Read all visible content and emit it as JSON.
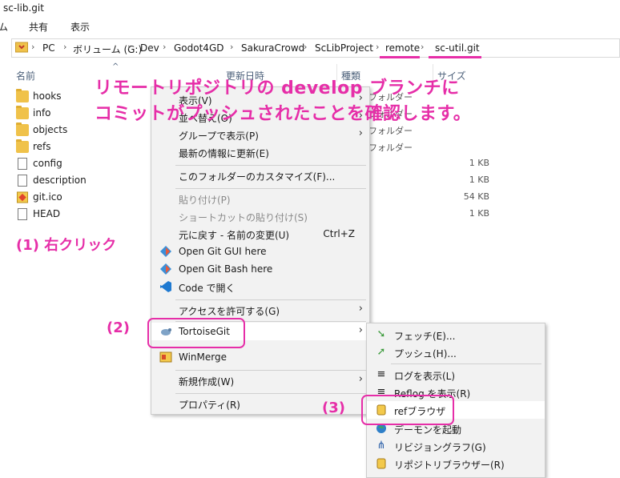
{
  "window": {
    "title": "sc-lib.git"
  },
  "ribbon": {
    "tabs": [
      "ム",
      "共有",
      "表示"
    ]
  },
  "address": {
    "crumbs": [
      "PC",
      "ボリューム (G:)",
      "Dev",
      "Godot4GD",
      "SakuraCrowd",
      "ScLibProject",
      "remote",
      "sc-util.git"
    ],
    "separator": "›"
  },
  "columns": {
    "name": "名前",
    "date": "更新日時",
    "type": "種類",
    "size": "サイズ"
  },
  "files": [
    {
      "name": "hooks",
      "kind": "folder",
      "type": "",
      "size": ""
    },
    {
      "name": "info",
      "kind": "folder",
      "type": "",
      "size": ""
    },
    {
      "name": "objects",
      "kind": "folder",
      "type": "フォルダー",
      "size": ""
    },
    {
      "name": "refs",
      "kind": "folder",
      "type": "フォルダー",
      "size": ""
    },
    {
      "name": "config",
      "kind": "file",
      "type": "",
      "size": "1 KB"
    },
    {
      "name": "description",
      "kind": "file",
      "type": "",
      "size": "1 KB"
    },
    {
      "name": "git.ico",
      "kind": "icon",
      "type": "",
      "size": "54 KB"
    },
    {
      "name": "HEAD",
      "kind": "file",
      "type": "",
      "size": "1 KB"
    }
  ],
  "folder_type_partial": "フォルダー",
  "annotations": {
    "headline_line1": "リモートリポジトリの develop ブランチに",
    "headline_line2": "コミットがプッシュされたことを確認します。",
    "step1": "(1) 右クリック",
    "step2": "(2)",
    "step3": "(3)"
  },
  "context_menu": {
    "items": [
      {
        "label": "表示(V)",
        "arrow": "›"
      },
      {
        "label": "並べ替え(O)",
        "arrow": "›"
      },
      {
        "label": "グループで表示(P)",
        "arrow": "›"
      },
      {
        "label": "最新の情報に更新(E)"
      },
      {
        "label": "このフォルダーのカスタマイズ(F)..."
      },
      {
        "label": "貼り付け(P)"
      },
      {
        "label": "ショートカットの貼り付け(S)"
      },
      {
        "label": "元に戻す - 名前の変更(U)",
        "accel": "Ctrl+Z"
      },
      {
        "label": "Open Git GUI here"
      },
      {
        "label": "Open Git Bash here"
      },
      {
        "label": "Code で開く"
      },
      {
        "label": "アクセスを許可する(G)",
        "arrow": "›"
      },
      {
        "label": "TortoiseGit",
        "arrow": "›"
      },
      {
        "label": "WinMerge"
      },
      {
        "label": "新規作成(W)",
        "arrow": "›"
      },
      {
        "label": "プロパティ(R)"
      }
    ]
  },
  "submenu": {
    "items": [
      {
        "label": "フェッチ(E)..."
      },
      {
        "label": "プッシュ(H)..."
      },
      {
        "label": "ログを表示(L)"
      },
      {
        "label": "Reflog を表示(R)"
      },
      {
        "label": "refブラウザ"
      },
      {
        "label": "デーモンを起動"
      },
      {
        "label": "リビジョングラフ(G)"
      },
      {
        "label": "リポジトリブラウザー(R)"
      }
    ]
  },
  "colors": {
    "annotation": "#e62ea8",
    "menu_bg": "#f2f2f2",
    "folder": "#f0c24a"
  }
}
